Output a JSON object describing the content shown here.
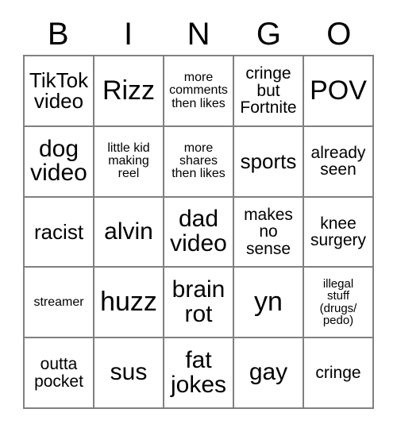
{
  "card": {
    "headers": [
      "B",
      "I",
      "N",
      "G",
      "O"
    ],
    "colors": {
      "grid_line": "#808080",
      "cell_background": "#ffffff",
      "text": "#000000",
      "page_background": "#ffffff"
    },
    "rows": [
      [
        {
          "text": "TikTok\nvideo",
          "size": "fs-md"
        },
        {
          "text": "Rizz",
          "size": "fs-xl"
        },
        {
          "text": "more\ncomments\nthen likes",
          "size": "fs-xs"
        },
        {
          "text": "cringe\nbut\nFortnite",
          "size": "fs-sm"
        },
        {
          "text": "POV",
          "size": "fs-xl"
        }
      ],
      [
        {
          "text": "dog\nvideo",
          "size": "fs-lg"
        },
        {
          "text": "little kid\nmaking\nreel",
          "size": "fs-xs"
        },
        {
          "text": "more\nshares\nthen likes",
          "size": "fs-xs"
        },
        {
          "text": "sports",
          "size": "fs-md"
        },
        {
          "text": "already\nseen",
          "size": "fs-sm"
        }
      ],
      [
        {
          "text": "racist",
          "size": "fs-md"
        },
        {
          "text": "alvin",
          "size": "fs-lg"
        },
        {
          "text": "dad\nvideo",
          "size": "fs-lg"
        },
        {
          "text": "makes\nno\nsense",
          "size": "fs-sm"
        },
        {
          "text": "knee\nsurgery",
          "size": "fs-sm"
        }
      ],
      [
        {
          "text": "streamer",
          "size": "fs-xs"
        },
        {
          "text": "huzz",
          "size": "fs-xl"
        },
        {
          "text": "brain\nrot",
          "size": "fs-lg"
        },
        {
          "text": "yn",
          "size": "fs-xl"
        },
        {
          "text": "illegal\nstuff\n(drugs/\npedo)",
          "size": "fs-xxs"
        }
      ],
      [
        {
          "text": "outta\npocket",
          "size": "fs-sm"
        },
        {
          "text": "sus",
          "size": "fs-lg"
        },
        {
          "text": "fat\njokes",
          "size": "fs-lg"
        },
        {
          "text": "gay",
          "size": "fs-lg"
        },
        {
          "text": "cringe",
          "size": "fs-sm"
        }
      ]
    ]
  }
}
